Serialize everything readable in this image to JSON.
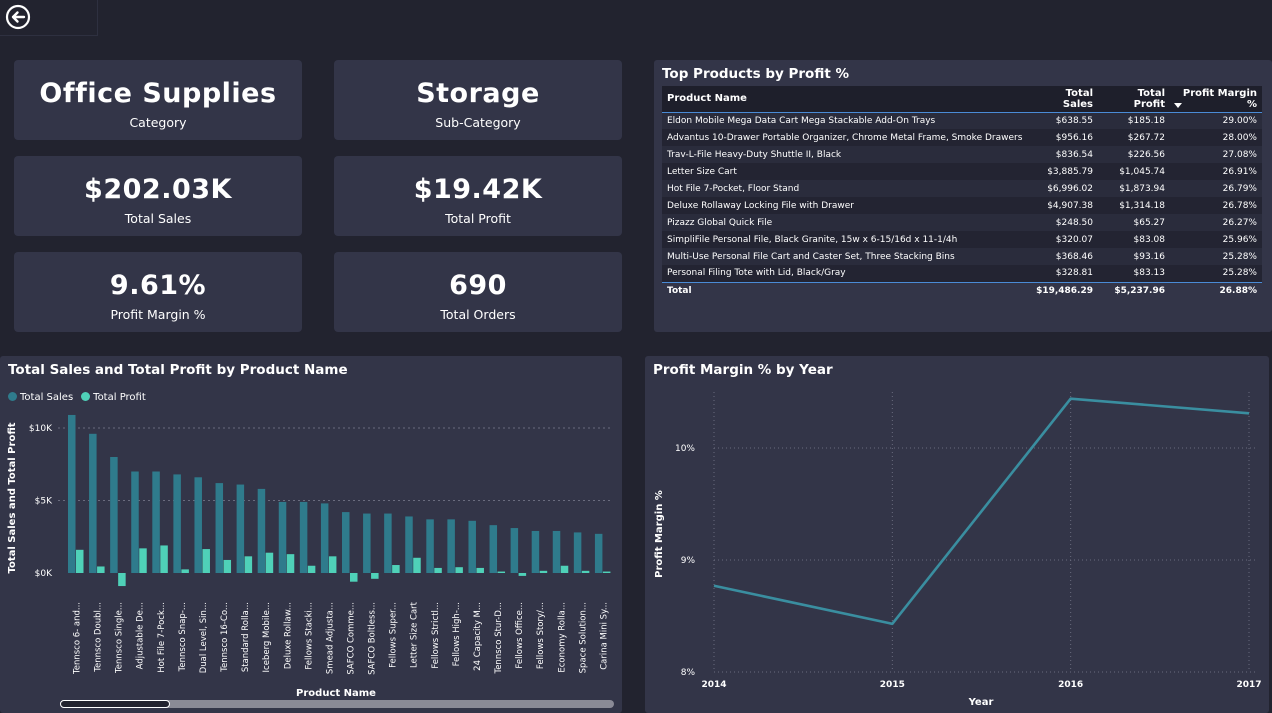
{
  "colors": {
    "background": "#22232f",
    "panel": "#333548",
    "total_sales": "#2f7b8c",
    "total_profit": "#4fd1b8",
    "line": "#3a8ea0",
    "grid": "#6a6c7e"
  },
  "cards": {
    "category": {
      "value": "Office Supplies",
      "label": "Category"
    },
    "subcategory": {
      "value": "Storage",
      "label": "Sub-Category"
    },
    "total_sales": {
      "value": "$202.03K",
      "label": "Total Sales"
    },
    "total_profit": {
      "value": "$19.42K",
      "label": "Total Profit"
    },
    "profit_margin": {
      "value": "9.61%",
      "label": "Profit Margin %"
    },
    "total_orders": {
      "value": "690",
      "label": "Total Orders"
    }
  },
  "top_products": {
    "title": "Top Products by Profit %",
    "columns": [
      "Product Name",
      "Total Sales",
      "Total Profit",
      "Profit Margin %"
    ],
    "rows": [
      [
        "Eldon Mobile Mega Data Cart Mega Stackable Add-On Trays",
        "$638.55",
        "$185.18",
        "29.00%"
      ],
      [
        "Advantus 10-Drawer Portable Organizer, Chrome Metal Frame, Smoke Drawers",
        "$956.16",
        "$267.72",
        "28.00%"
      ],
      [
        "Trav-L-File Heavy-Duty Shuttle II, Black",
        "$836.54",
        "$226.56",
        "27.08%"
      ],
      [
        "Letter Size Cart",
        "$3,885.79",
        "$1,045.74",
        "26.91%"
      ],
      [
        "Hot File 7-Pocket, Floor Stand",
        "$6,996.02",
        "$1,873.94",
        "26.79%"
      ],
      [
        "Deluxe Rollaway Locking File with Drawer",
        "$4,907.38",
        "$1,314.18",
        "26.78%"
      ],
      [
        "Pizazz Global Quick File",
        "$248.50",
        "$65.27",
        "26.27%"
      ],
      [
        "SimpliFile Personal File, Black Granite, 15w x 6-15/16d x 11-1/4h",
        "$320.07",
        "$83.08",
        "25.96%"
      ],
      [
        "Multi-Use Personal File Cart and Caster Set, Three Stacking Bins",
        "$368.46",
        "$93.16",
        "25.28%"
      ],
      [
        "Personal Filing Tote with Lid, Black/Gray",
        "$328.81",
        "$83.13",
        "25.28%"
      ]
    ],
    "total": [
      "Total",
      "$19,486.29",
      "$5,237.96",
      "26.88%"
    ]
  },
  "chart_data": [
    {
      "type": "bar",
      "title": "Total Sales and Total Profit by Product Name",
      "xlabel": "Product Name",
      "ylabel": "Total Sales and Total Profit",
      "ylim": [
        -1500,
        11000
      ],
      "yticks": [
        0,
        5000,
        10000
      ],
      "ytick_labels": [
        "$0K",
        "$5K",
        "$10K"
      ],
      "legend_position": "top-left",
      "categories": [
        "Tennsco 6- and...",
        "Tennsco Doubl...",
        "Tennsco Single...",
        "Adjustable De...",
        "Hot File 7-Pock...",
        "Tennsco Snap-...",
        "Dual Level, Sin...",
        "Tennsco 16-Co...",
        "Standard Rolla...",
        "Iceberg Mobile...",
        "Deluxe Rollaw...",
        "Fellows Stacki...",
        "Smead Adjusta...",
        "SAFCO Comme...",
        "SAFCO Boltless...",
        "Fellows Super...",
        "Letter Size Cart",
        "Fellows Strictl...",
        "Fellows High-...",
        "24 Capacity M...",
        "Tennsco Stur-D...",
        "Fellows Office...",
        "Fellows Story/...",
        "Economy Rolla...",
        "Space Solution...",
        "Carina Mini Sy..."
      ],
      "series": [
        {
          "name": "Total Sales",
          "values": [
            10900,
            9600,
            8000,
            7000,
            7000,
            6800,
            6600,
            6200,
            6100,
            5800,
            4900,
            4900,
            4800,
            4200,
            4100,
            4100,
            3900,
            3700,
            3700,
            3600,
            3300,
            3100,
            2900,
            2900,
            2800,
            2700
          ]
        },
        {
          "name": "Total Profit",
          "values": [
            1600,
            450,
            -900,
            1700,
            1900,
            250,
            1650,
            900,
            1150,
            1400,
            1300,
            500,
            1150,
            -600,
            -400,
            550,
            1050,
            350,
            400,
            350,
            100,
            -200,
            150,
            500,
            150,
            100
          ]
        }
      ]
    },
    {
      "type": "line",
      "title": "Profit Margin % by Year",
      "xlabel": "Year",
      "ylabel": "Profit Margin %",
      "ylim": [
        8,
        10.5
      ],
      "yticks": [
        8,
        9,
        10
      ],
      "ytick_labels": [
        "8%",
        "9%",
        "10%"
      ],
      "grid": true,
      "x": [
        2014,
        2015,
        2016,
        2017
      ],
      "series": [
        {
          "name": "Profit Margin %",
          "values": [
            8.77,
            8.43,
            10.44,
            10.31
          ]
        }
      ]
    }
  ]
}
